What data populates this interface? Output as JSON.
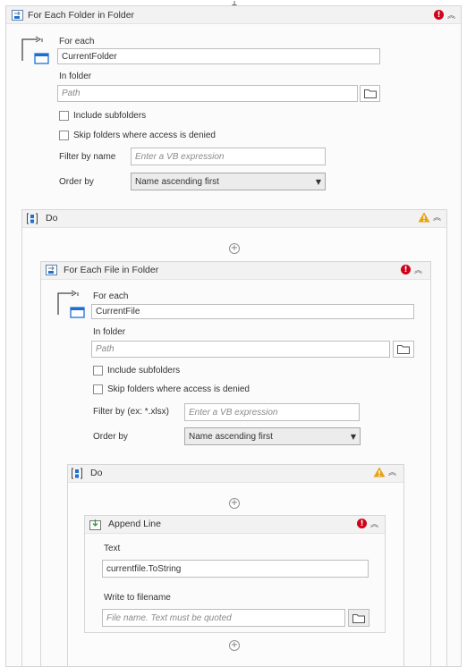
{
  "outer": {
    "title": "For Each Folder in Folder",
    "for_each_label": "For each",
    "item_value": "CurrentFolder",
    "in_folder_label": "In folder",
    "in_folder_placeholder": "Path",
    "include_subfolders": "Include subfolders",
    "skip_denied": "Skip folders where access is denied",
    "filter_label": "Filter by name",
    "filter_placeholder": "Enter a VB expression",
    "order_label": "Order by",
    "order_value": "Name ascending first"
  },
  "do1": {
    "title": "Do"
  },
  "inner": {
    "title": "For Each File in Folder",
    "for_each_label": "For each",
    "item_value": "CurrentFile",
    "in_folder_label": "In folder",
    "in_folder_placeholder": "Path",
    "include_subfolders": "Include subfolders",
    "skip_denied": "Skip folders where access is denied",
    "filter_label": "Filter by (ex: *.xlsx)",
    "filter_placeholder": "Enter a VB expression",
    "order_label": "Order by",
    "order_value": "Name ascending first"
  },
  "do2": {
    "title": "Do"
  },
  "append": {
    "title": "Append Line",
    "text_label": "Text",
    "text_value": "currentfile.ToString",
    "write_label": "Write to filename",
    "write_placeholder": "File name. Text must be quoted"
  },
  "colors": {
    "error": "#d0021b",
    "warning": "#e8a317",
    "icon_blue": "#1f6fd1"
  }
}
